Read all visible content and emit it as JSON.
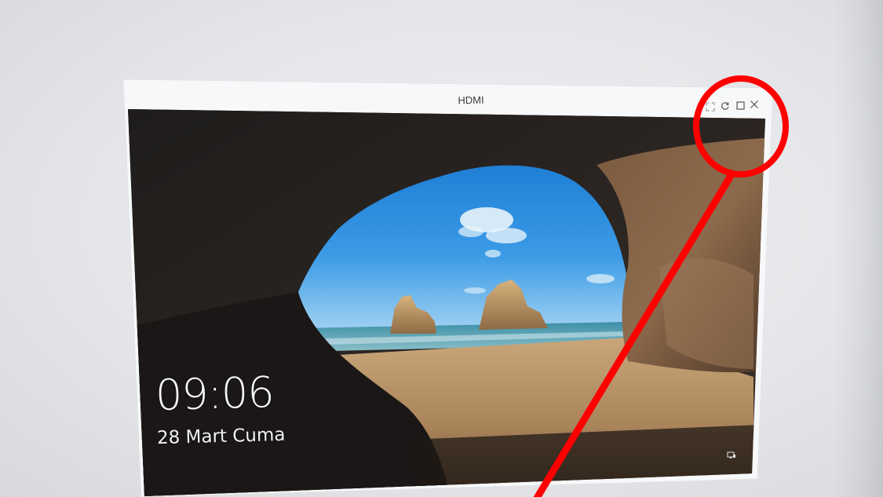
{
  "window": {
    "title": "HDMI",
    "controls": {
      "expand_icon": "expand-icon",
      "rotate_icon": "rotate-icon",
      "maximize_icon": "maximize-icon",
      "close_icon": "close-icon"
    }
  },
  "lockscreen": {
    "time": "09:06",
    "date": "28 Mart Cuma",
    "network_icon": "network-icon"
  },
  "annotation": {
    "shape": "circle-with-pointer-line",
    "color": "#ff0000"
  }
}
